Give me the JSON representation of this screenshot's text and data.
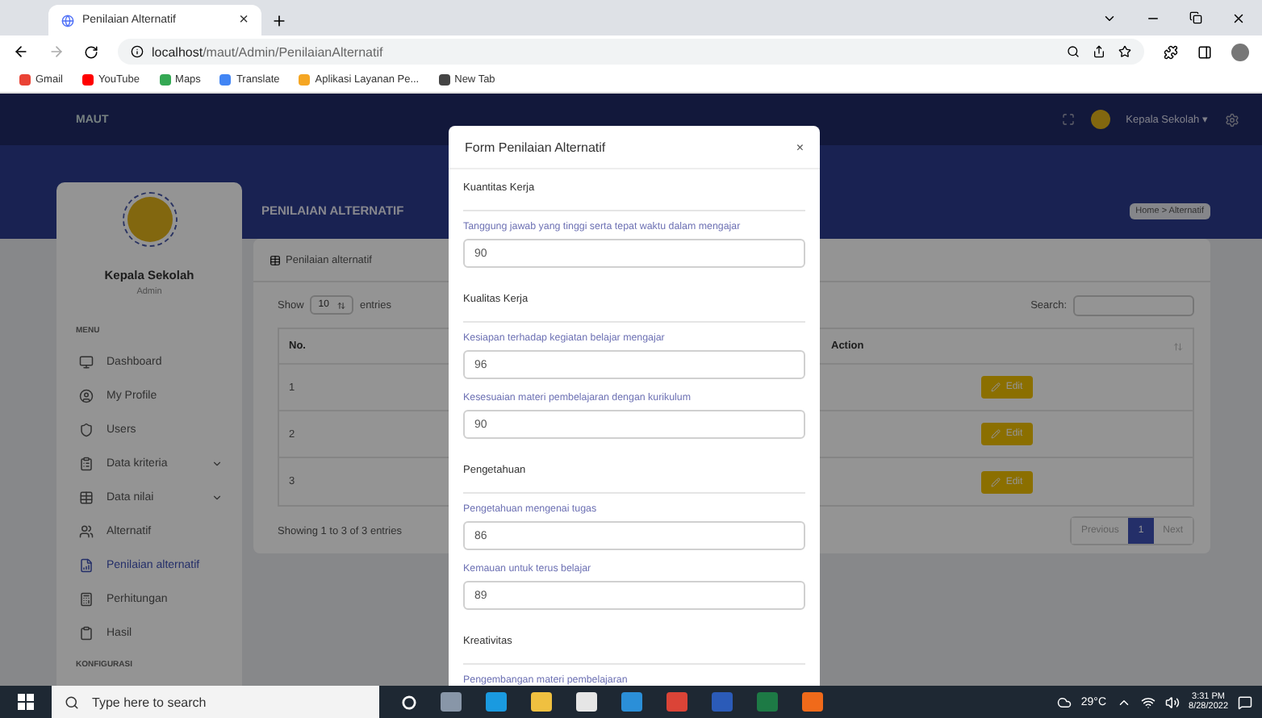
{
  "browser": {
    "tab": {
      "title": "Penilaian Alternatif",
      "close": "×"
    },
    "url_host": "localhost",
    "url_path": "/maut/Admin/PenilaianAlternatif",
    "bookmarks": [
      "Gmail",
      "YouTube",
      "Maps",
      "Translate",
      "Aplikasi Layanan Pe...",
      "New Tab"
    ]
  },
  "app": {
    "brand": "MAUT",
    "user": "Kepala Sekolah",
    "user_caret": "▾",
    "page_title": "PENILAIAN ALTERNATIF",
    "breadcrumb": "Home > Alternatif",
    "sidebar": {
      "name": "Kepala Sekolah",
      "role": "Admin",
      "menu_heading": "MENU",
      "items": [
        {
          "label": "Dashboard",
          "selected": false,
          "expandable": false
        },
        {
          "label": "My Profile",
          "selected": false,
          "expandable": false
        },
        {
          "label": "Users",
          "selected": false,
          "expandable": false
        },
        {
          "label": "Data kriteria",
          "selected": false,
          "expandable": true
        },
        {
          "label": "Data nilai",
          "selected": false,
          "expandable": true
        },
        {
          "label": "Alternatif",
          "selected": false,
          "expandable": false
        },
        {
          "label": "Penilaian alternatif",
          "selected": true,
          "expandable": false
        },
        {
          "label": "Perhitungan",
          "selected": false,
          "expandable": false
        },
        {
          "label": "Hasil",
          "selected": false,
          "expandable": false
        }
      ],
      "config_heading": "KONFIGURASI"
    },
    "card": {
      "title": "Penilaian alternatif",
      "show_label": "Show",
      "page_size": "10",
      "entries_label": "entries",
      "search_label": "Search:",
      "columns": [
        "No.",
        "Action"
      ],
      "rows": [
        {
          "no": "1",
          "action": "Edit"
        },
        {
          "no": "2",
          "action": "Edit"
        },
        {
          "no": "3",
          "action": "Edit"
        }
      ],
      "info": "Showing 1 to 3 of 3 entries",
      "pagination": [
        {
          "label": "Previous",
          "selected": false
        },
        {
          "label": "1",
          "selected": true
        },
        {
          "label": "Next",
          "selected": false
        }
      ]
    }
  },
  "modal": {
    "title": "Form Penilaian Alternatif",
    "close": "×",
    "groups": [
      {
        "heading": "Kuantitas Kerja",
        "fields": [
          {
            "label": "Tanggung jawab yang tinggi serta tepat waktu dalam mengajar",
            "value": "90"
          }
        ]
      },
      {
        "heading": "Kualitas Kerja",
        "fields": [
          {
            "label": "Kesiapan terhadap kegiatan belajar mengajar",
            "value": "96"
          },
          {
            "label": "Kesesuaian materi pembelajaran dengan kurikulum",
            "value": "90"
          }
        ]
      },
      {
        "heading": "Pengetahuan",
        "fields": [
          {
            "label": "Pengetahuan mengenai tugas",
            "value": "86"
          },
          {
            "label": "Kemauan untuk terus belajar",
            "value": "89"
          }
        ]
      },
      {
        "heading": "Kreativitas",
        "fields": [
          {
            "label": "Pengembangan materi pembelajaran"
          }
        ]
      }
    ]
  },
  "taskbar": {
    "search_placeholder": "Type here to search",
    "weather": "29°C",
    "time": "3:31 PM",
    "date": "8/28/2022"
  }
}
